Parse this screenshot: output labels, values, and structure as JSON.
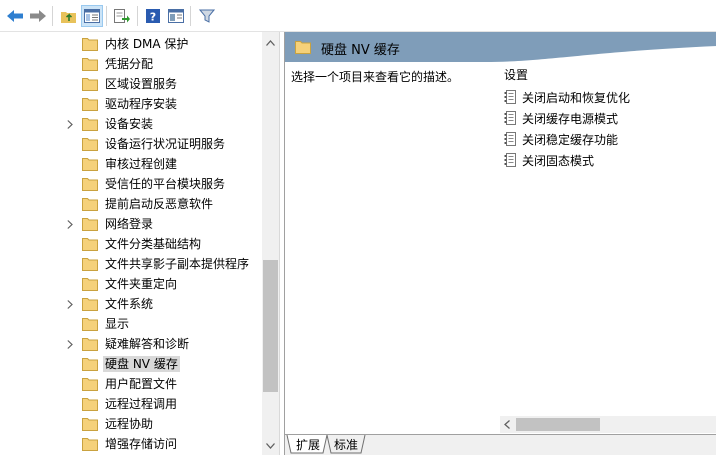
{
  "toolbar": {
    "buttons": [
      "back-icon",
      "forward-icon",
      "up-folder-icon",
      "show-hide-tree-icon",
      "export-list-icon",
      "help-icon",
      "properties-icon",
      "filter-icon"
    ]
  },
  "tree": {
    "items": [
      {
        "label": "内核 DMA 保护",
        "expandable": false
      },
      {
        "label": "凭据分配",
        "expandable": false
      },
      {
        "label": "区域设置服务",
        "expandable": false
      },
      {
        "label": "驱动程序安装",
        "expandable": false
      },
      {
        "label": "设备安装",
        "expandable": true
      },
      {
        "label": "设备运行状况证明服务",
        "expandable": false
      },
      {
        "label": "审核过程创建",
        "expandable": false
      },
      {
        "label": "受信任的平台模块服务",
        "expandable": false
      },
      {
        "label": "提前启动反恶意软件",
        "expandable": false
      },
      {
        "label": "网络登录",
        "expandable": true
      },
      {
        "label": "文件分类基础结构",
        "expandable": false
      },
      {
        "label": "文件共享影子副本提供程序",
        "expandable": false
      },
      {
        "label": "文件夹重定向",
        "expandable": false
      },
      {
        "label": "文件系统",
        "expandable": true
      },
      {
        "label": "显示",
        "expandable": false
      },
      {
        "label": "疑难解答和诊断",
        "expandable": true
      },
      {
        "label": "硬盘 NV 缓存",
        "expandable": false,
        "selected": true
      },
      {
        "label": "用户配置文件",
        "expandable": false
      },
      {
        "label": "远程过程调用",
        "expandable": false
      },
      {
        "label": "远程协助",
        "expandable": false
      },
      {
        "label": "增强存储访问",
        "expandable": false
      }
    ]
  },
  "right": {
    "title": "硬盘 NV 缓存",
    "description": "选择一个项目来查看它的描述。",
    "settings_header": "设置",
    "settings": [
      "关闭启动和恢复优化",
      "关闭缓存电源模式",
      "关闭稳定缓存功能",
      "关闭固态模式"
    ]
  },
  "tabs": {
    "extended": "扩展",
    "standard": "标准"
  },
  "colors": {
    "header_band": "#7f9db9",
    "selection": "#d9d9d9",
    "folder": "#f5d17a"
  }
}
